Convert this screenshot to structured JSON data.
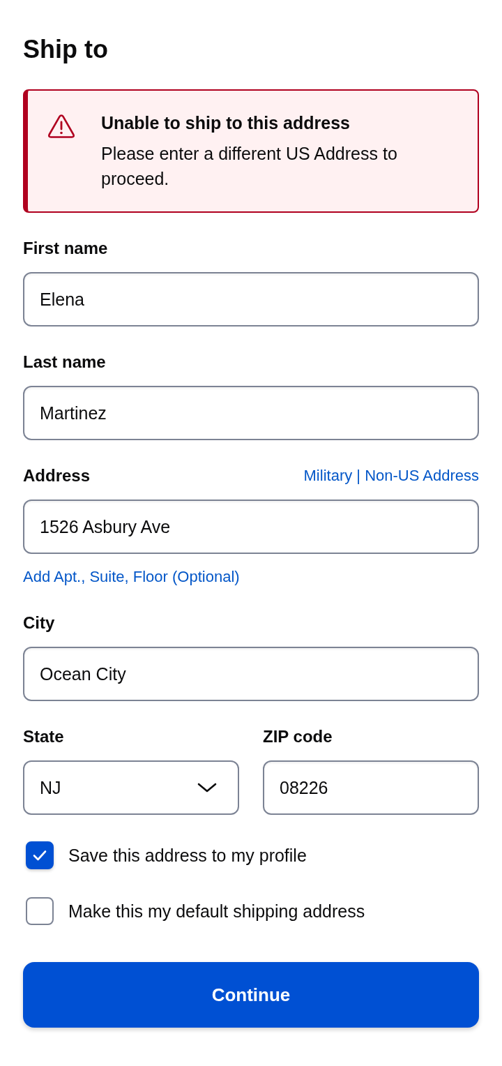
{
  "page": {
    "title": "Ship to"
  },
  "alert": {
    "kind": "error",
    "title": "Unable to ship to this address",
    "message": "Please enter a different US Address to proceed."
  },
  "rows": [
    {
      "fields": [
        {
          "kind": "text",
          "label": "First name",
          "value": "Elena"
        }
      ]
    },
    {
      "fields": [
        {
          "kind": "text",
          "label": "Last name",
          "value": "Martinez"
        }
      ]
    },
    {
      "fields": [
        {
          "kind": "text",
          "label": "Address",
          "value": "1526 Asbury Ave",
          "header_link": "Military | Non-US Address",
          "footer_link": "Add Apt., Suite, Floor (Optional)"
        }
      ]
    },
    {
      "fields": [
        {
          "kind": "text",
          "label": "City",
          "value": "Ocean City"
        }
      ]
    },
    {
      "fields": [
        {
          "kind": "select",
          "label": "State",
          "value": "NJ"
        },
        {
          "kind": "text",
          "label": "ZIP code",
          "value": "08226"
        }
      ]
    }
  ],
  "checkboxes": [
    {
      "label": "Save this address to my profile",
      "checked": true
    },
    {
      "label": "Make this my default shipping address",
      "checked": false
    }
  ],
  "button": {
    "label": "Continue"
  }
}
